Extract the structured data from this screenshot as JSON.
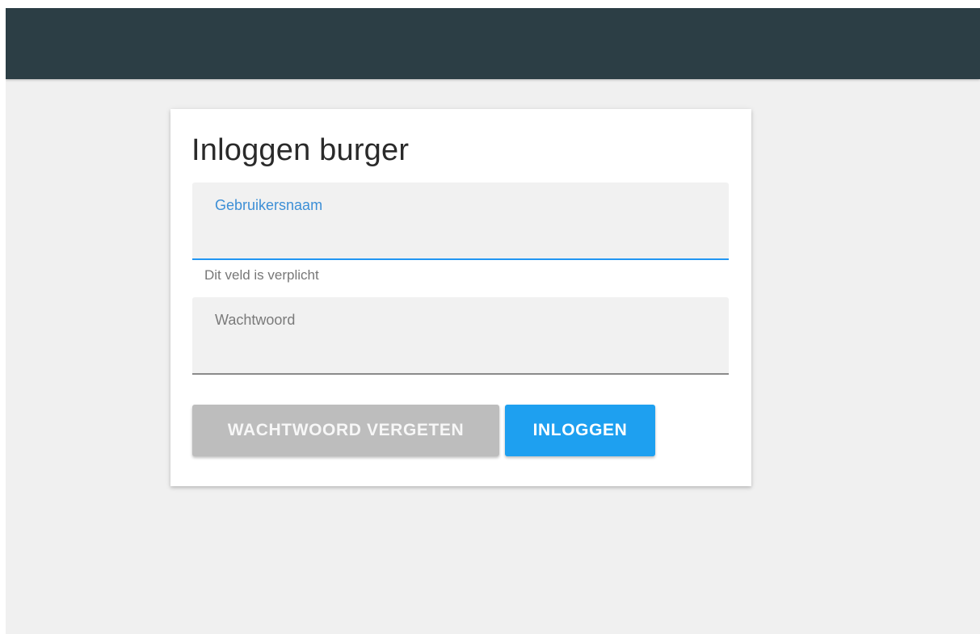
{
  "colors": {
    "header": "#2c3e45",
    "background": "#f0f0f0",
    "accent": "#2196f3",
    "primary_button": "#1ea0f0",
    "secondary_button": "#bdbdbd"
  },
  "login": {
    "title": "Inloggen burger",
    "username": {
      "label": "Gebruikersnaam",
      "value": "",
      "helper": "Dit veld is verplicht"
    },
    "password": {
      "label": "Wachtwoord",
      "value": ""
    },
    "buttons": {
      "forgot": "WACHTWOORD VERGETEN",
      "login": "INLOGGEN"
    }
  }
}
